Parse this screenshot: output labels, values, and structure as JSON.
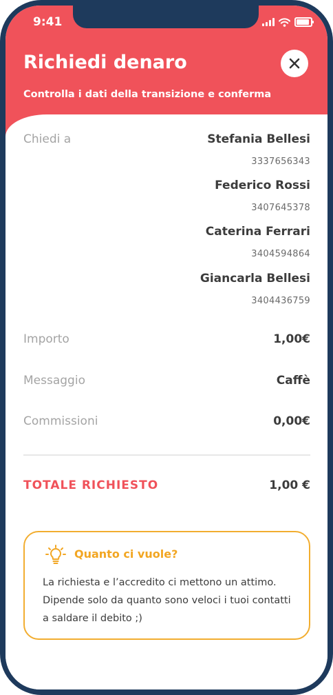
{
  "status_bar": {
    "time": "9:41"
  },
  "header": {
    "title": "Richiedi denaro",
    "subtitle": "Controlla i dati della transizione e conferma"
  },
  "recipients_label": "Chiedi a",
  "recipients": [
    {
      "name": "Stefania Bellesi",
      "phone": "3337656343"
    },
    {
      "name": "Federico Rossi",
      "phone": "3407645378"
    },
    {
      "name": "Caterina Ferrari",
      "phone": "3404594864"
    },
    {
      "name": "Giancarla Bellesi",
      "phone": "3404436759"
    }
  ],
  "details": {
    "amount_label": "Importo",
    "amount_value": "1,00€",
    "message_label": "Messaggio",
    "message_value": "Caffè",
    "fees_label": "Commissioni",
    "fees_value": "0,00€"
  },
  "total": {
    "label": "TOTALE RICHIESTO",
    "value": "1,00 €"
  },
  "info_card": {
    "title": "Quanto ci vuole?",
    "text": "La richiesta e l’accredito ci mettono un attimo. Dipende solo da quanto sono veloci i tuoi contatti a saldare il debito ;)"
  },
  "colors": {
    "header": "#f0525a",
    "device_frame": "#1e3a5c",
    "info_accent": "#f2ad2f"
  },
  "icons": [
    "close-icon",
    "lightbulb-icon",
    "signal-icon",
    "wifi-icon",
    "battery-icon"
  ]
}
